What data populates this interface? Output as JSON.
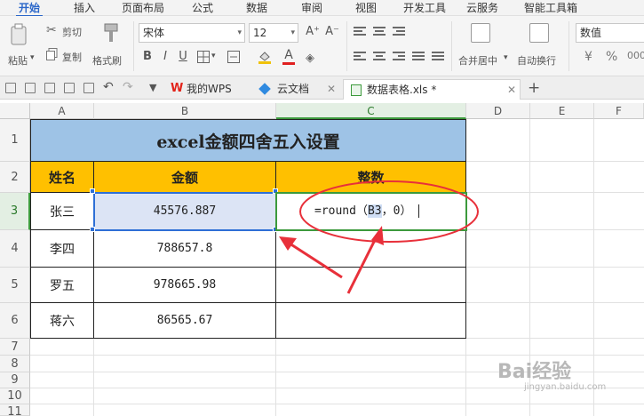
{
  "menu": {
    "tabs": [
      {
        "label": "开始",
        "active": true
      },
      {
        "label": "插入"
      },
      {
        "label": "页面布局"
      },
      {
        "label": "公式"
      },
      {
        "label": "数据"
      },
      {
        "label": "审阅"
      },
      {
        "label": "视图"
      },
      {
        "label": "开发工具"
      },
      {
        "label": "云服务"
      },
      {
        "label": "智能工具箱"
      }
    ]
  },
  "ribbon": {
    "cut": "剪切",
    "paste": "粘贴",
    "copy": "复制",
    "format_painter": "格式刷",
    "font_name": "宋体",
    "font_size": "12",
    "merge_center": "合并居中",
    "wrap_text": "自动换行",
    "number_format": "数值",
    "percent": "%",
    "bold": "B",
    "italic": "I",
    "underline": "U",
    "font_color": "A",
    "grow_font": "A⁺",
    "shrink_font": "A⁻"
  },
  "quickbar": {
    "tabs": [
      {
        "label": "我的WPS",
        "icon": "wps-logo-icon"
      },
      {
        "label": "云文档",
        "icon": "cloud-doc-icon"
      },
      {
        "label": "数据表格.xls *",
        "icon": "sheet-file-icon",
        "active": true
      }
    ],
    "add": "+"
  },
  "sheet": {
    "columns": [
      "A",
      "B",
      "C",
      "D",
      "E",
      "F"
    ],
    "rows": [
      "1",
      "2",
      "3",
      "4",
      "5",
      "6",
      "7",
      "8",
      "9",
      "10",
      "11"
    ],
    "title": "excel金额四舍五入设置",
    "headers": [
      "姓名",
      "金额",
      "整数"
    ],
    "data": [
      {
        "name": "张三",
        "amount": "45576.887"
      },
      {
        "name": "李四",
        "amount": "788657.8"
      },
      {
        "name": "罗五",
        "amount": "978665.98"
      },
      {
        "name": "蒋六",
        "amount": "86565.67"
      }
    ],
    "editing": {
      "prefix": "=round（",
      "ref": "B3",
      "suffix": "，0）"
    }
  },
  "colors": {
    "title_fill": "#9ec3e6",
    "header_fill": "#ffc000",
    "selection": "#2e6fd6",
    "annotation": "#e8303a",
    "active_tab": "#2a66c9"
  },
  "watermark": {
    "brand": "Bai经验",
    "url": "jingyan.baidu.com"
  }
}
